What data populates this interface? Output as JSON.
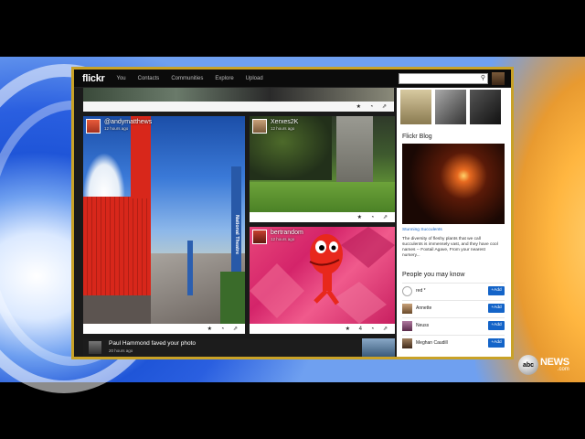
{
  "topbar": {
    "logo": "flickr",
    "nav": [
      "You",
      "Contacts",
      "Communities",
      "Explore",
      "Upload"
    ],
    "search_placeholder": ""
  },
  "feed": {
    "top_strip_icons": "★ ◔ ⇗",
    "card1": {
      "user": "@andymatthews",
      "time": "12 hours ago",
      "icons": "★ ◔ ⇗",
      "sign_text": "National Theatre"
    },
    "card2": {
      "user": "Xerxes2K",
      "time": "12 hours ago",
      "icons": "★ ◔ ⇗"
    },
    "card3": {
      "user": "bertrandom",
      "time": "12 hours ago",
      "icons": "★ 4 ◔ ⇗"
    },
    "activity": {
      "text": "Paul Hammond faved your photo",
      "time": "20 hours ago"
    }
  },
  "sidebar": {
    "blog_title": "Flickr Blog",
    "post_title": "Stunning Succulents",
    "post_text_1": "The diversity of fleshy plants that we call",
    "post_text_2": "succulents is immensely vast, and they have cool",
    "post_text_3": "names -- Foxtail Agave, From your nearest",
    "post_text_4": "nursery...",
    "pymk_title": "People you may know",
    "people": [
      {
        "name": "red *",
        "button": "+Add"
      },
      {
        "name": "Annette",
        "button": "+Add"
      },
      {
        "name": "Neuss",
        "button": "+Add"
      },
      {
        "name": "Meghan Caudill",
        "button": "+Add"
      }
    ]
  },
  "broadcast": {
    "brand": "abc",
    "news": "NEWS",
    "domain": ".com"
  },
  "colors": {
    "frame_border": "#c9a227",
    "add_button": "#1464c8",
    "link_blue": "#1464c8"
  }
}
